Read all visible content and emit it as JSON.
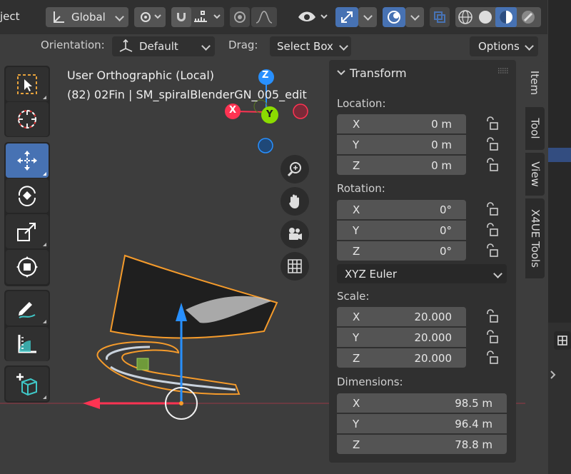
{
  "header": {
    "menu_partial": "ject",
    "transform_orientation": "Global",
    "orientation_label": "Orientation:",
    "orientation_value": "Default",
    "drag_label": "Drag:",
    "drag_value": "Select Box",
    "options_label": "Options"
  },
  "viewport": {
    "view_name": "User Orthographic (Local)",
    "object_info": "(82) 02Fin | SM_spiralBlenderGN_005_edit",
    "gizmo": {
      "x": "X",
      "y": "Y",
      "z": "Z"
    }
  },
  "npanel": {
    "title": "Transform",
    "location_label": "Location:",
    "location": [
      {
        "axis": "X",
        "value": "0 m"
      },
      {
        "axis": "Y",
        "value": "0 m"
      },
      {
        "axis": "Z",
        "value": "0 m"
      }
    ],
    "rotation_label": "Rotation:",
    "rotation": [
      {
        "axis": "X",
        "value": "0°"
      },
      {
        "axis": "Y",
        "value": "0°"
      },
      {
        "axis": "Z",
        "value": "0°"
      }
    ],
    "rotation_mode": "XYZ Euler",
    "scale_label": "Scale:",
    "scale": [
      {
        "axis": "X",
        "value": "20.000"
      },
      {
        "axis": "Y",
        "value": "20.000"
      },
      {
        "axis": "Z",
        "value": "20.000"
      }
    ],
    "dimensions_label": "Dimensions:",
    "dimensions": [
      {
        "axis": "X",
        "value": "98.5 m"
      },
      {
        "axis": "Y",
        "value": "96.4 m"
      },
      {
        "axis": "Z",
        "value": "78.8 m"
      }
    ]
  },
  "side_tabs": [
    "Item",
    "Tool",
    "View",
    "X4UE Tools"
  ],
  "colors": {
    "accent": "#4772b3",
    "axis_x": "#ff3352",
    "axis_y": "#8bdc00",
    "axis_z": "#2890ff",
    "selection_outline": "#f59b2b"
  }
}
